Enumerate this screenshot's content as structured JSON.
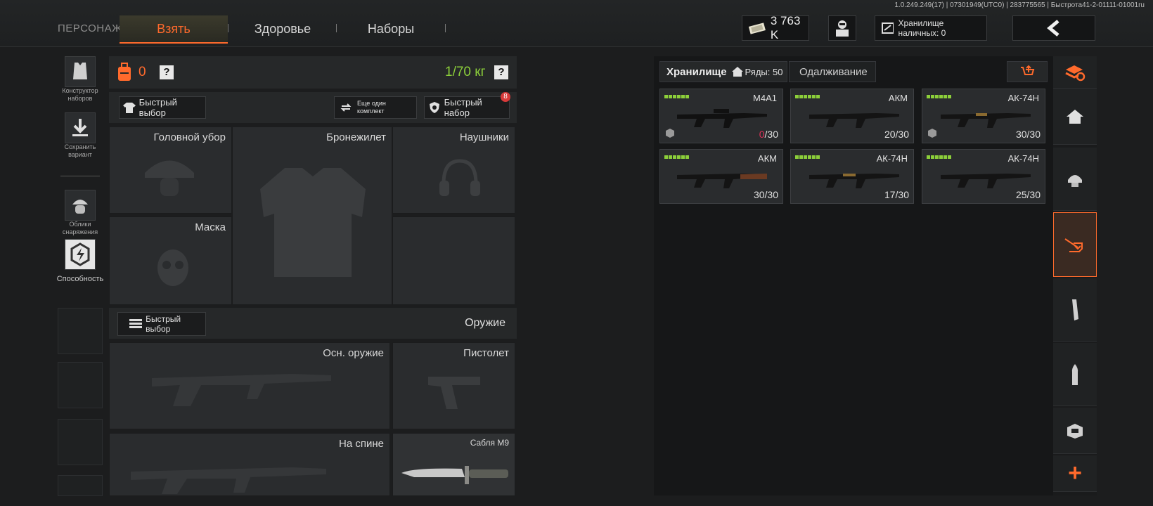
{
  "build_info": "1.0.249.249(17) | 07301949(UTC0) | 283775565 | Быстрота41-2-01111-01001ru",
  "header": {
    "section_label": "ПЕРСОНАЖ",
    "tabs": [
      {
        "label": "Взять",
        "active": true
      },
      {
        "label": "Здоровье",
        "active": false
      },
      {
        "label": "Наборы",
        "active": false
      }
    ],
    "currency": "3 763 K",
    "cash_storage": "Хранилище наличных: 0"
  },
  "left_panel": {
    "builder_caption": "Конструктор наборов",
    "save_caption": "Сохранить вариант",
    "skins_caption": "Облики снаряжения",
    "ability_caption": "Способность"
  },
  "loadout": {
    "backpack_count": "0",
    "weight": "1/70 кг",
    "help": "?",
    "quick_select": "Быстрый выбор",
    "another_set": "Еще один комплект",
    "quick_set": "Быстрый набор",
    "quick_set_badge": "8",
    "slots": {
      "headgear": "Головной убор",
      "vest": "Бронежилет",
      "headphones": "Наушники",
      "mask": "Маска"
    },
    "weapons_title": "Оружие",
    "weapons_quick_select": "Быстрый выбор",
    "weapon_slots": {
      "primary": "Осн. оружие",
      "pistol": "Пистолет",
      "back": "На спине",
      "melee": "Сабля M9"
    }
  },
  "storage": {
    "tab_storage": "Хранилище",
    "rows_label": "Ряды: 50",
    "tab_lending": "Одалживание",
    "items": [
      {
        "name": "M4A1",
        "ammo_current": "0",
        "ammo_total": "/30",
        "ammo_empty": true
      },
      {
        "name": "АКМ",
        "ammo_current": "20",
        "ammo_total": "/30",
        "ammo_empty": false
      },
      {
        "name": "АК-74Н",
        "ammo_current": "30",
        "ammo_total": "/30",
        "ammo_empty": false
      },
      {
        "name": "АКМ",
        "ammo_current": "30",
        "ammo_total": "/30",
        "ammo_empty": false
      },
      {
        "name": "АК-74Н",
        "ammo_current": "17",
        "ammo_total": "/30",
        "ammo_empty": false
      },
      {
        "name": "АК-74Н",
        "ammo_current": "25",
        "ammo_total": "/30",
        "ammo_empty": false
      }
    ]
  },
  "sidebar_plus": "+",
  "colors": {
    "accent": "#ff6a2c",
    "weight_green": "#8ccf3a",
    "empty_ammo": "#e0325a"
  }
}
